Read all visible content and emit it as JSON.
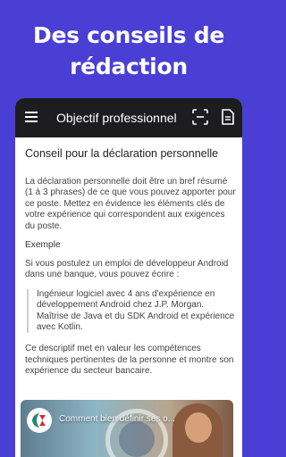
{
  "promo": {
    "title_line1": "Des conseils de",
    "title_line2": "rédaction"
  },
  "appbar": {
    "title": "Objectif professionnel",
    "icons": [
      "menu-icon",
      "scan-icon",
      "document-icon"
    ]
  },
  "article": {
    "heading": "Conseil pour la déclaration personnelle",
    "paragraph1": "La déclaration personnelle doit être un bref résumé (1 à 3 phrases) de ce que vous pouvez apporter pour ce poste. Mettez en évidence les éléments clés de votre expérience qui correspondent aux exigences du poste.",
    "example_label": "Exemple",
    "paragraph2": "Si vous postulez un emploi de développeur Android dans une banque, vous pouvez écrire :",
    "quote": "Ingénieur logiciel avec 4 ans d'expérience en développement Android chez J.P. Morgan. Maîtrise de Java et du SDK Android et expérience avec Kotlin.",
    "paragraph3": "Ce descriptif met en valeur les compétences techniques pertinentes de la personne et montre son expérience du secteur bancaire."
  },
  "video": {
    "title": "Comment bien définir ses o...",
    "channel_logo_text": "CA",
    "channel_color": "#1f8a70",
    "accent_red": "#d9262e"
  },
  "colors": {
    "background": "#4a3fd4",
    "appbar": "#1d1d1f"
  }
}
